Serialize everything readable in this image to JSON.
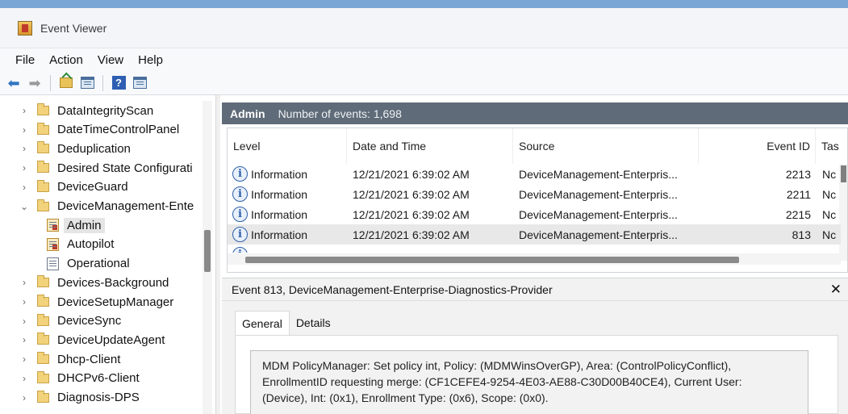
{
  "window": {
    "title": "Event Viewer"
  },
  "menu": [
    "File",
    "Action",
    "View",
    "Help"
  ],
  "toolbar": {
    "help_glyph": "?"
  },
  "tree": [
    {
      "label": "DataIntegrityScan",
      "expanded": false
    },
    {
      "label": "DateTimeControlPanel",
      "expanded": false
    },
    {
      "label": "Deduplication",
      "expanded": false
    },
    {
      "label": "Desired State Configurati",
      "expanded": false
    },
    {
      "label": "DeviceGuard",
      "expanded": false
    },
    {
      "label": "DeviceManagement-Ente",
      "expanded": true
    },
    {
      "label": "Admin",
      "child": true,
      "selected": true
    },
    {
      "label": "Autopilot",
      "child": true
    },
    {
      "label": "Operational",
      "child": true
    },
    {
      "label": "Devices-Background",
      "expanded": false
    },
    {
      "label": "DeviceSetupManager",
      "expanded": false
    },
    {
      "label": "DeviceSync",
      "expanded": false
    },
    {
      "label": "DeviceUpdateAgent",
      "expanded": false
    },
    {
      "label": "Dhcp-Client",
      "expanded": false
    },
    {
      "label": "DHCPv6-Client",
      "expanded": false
    },
    {
      "label": "Diagnosis-DPS",
      "expanded": false
    }
  ],
  "chevrons": {
    "collapsed": "›",
    "expanded": "⌄"
  },
  "events_panel": {
    "title": "Admin",
    "count_text": "Number of events: 1,698",
    "columns": [
      "Level",
      "Date and Time",
      "Source",
      "Event ID",
      "Tas"
    ],
    "rows": [
      {
        "level": "Information",
        "datetime": "12/21/2021 6:39:02 AM",
        "source": "DeviceManagement-Enterpris...",
        "event_id": "2213",
        "task": "Nc"
      },
      {
        "level": "Information",
        "datetime": "12/21/2021 6:39:02 AM",
        "source": "DeviceManagement-Enterpris...",
        "event_id": "2211",
        "task": "Nc"
      },
      {
        "level": "Information",
        "datetime": "12/21/2021 6:39:02 AM",
        "source": "DeviceManagement-Enterpris...",
        "event_id": "2215",
        "task": "Nc"
      },
      {
        "level": "Information",
        "datetime": "12/21/2021 6:39:02 AM",
        "source": "DeviceManagement-Enterpris...",
        "event_id": "813",
        "task": "Nc",
        "selected": true
      }
    ],
    "info_glyph": "i"
  },
  "detail": {
    "title": "Event 813, DeviceManagement-Enterprise-Diagnostics-Provider",
    "close_glyph": "✕",
    "tabs": [
      "General",
      "Details"
    ],
    "description": [
      "MDM PolicyManager: Set policy int, Policy: (MDMWinsOverGP), Area: (ControlPolicyConflict),",
      "EnrollmentID requesting merge: (CF1CEFE4-9254-4E03-AE88-C30D00B40CE4), Current User:",
      "(Device), Int: (0x1), Enrollment Type: (0x6), Scope: (0x0)."
    ]
  }
}
